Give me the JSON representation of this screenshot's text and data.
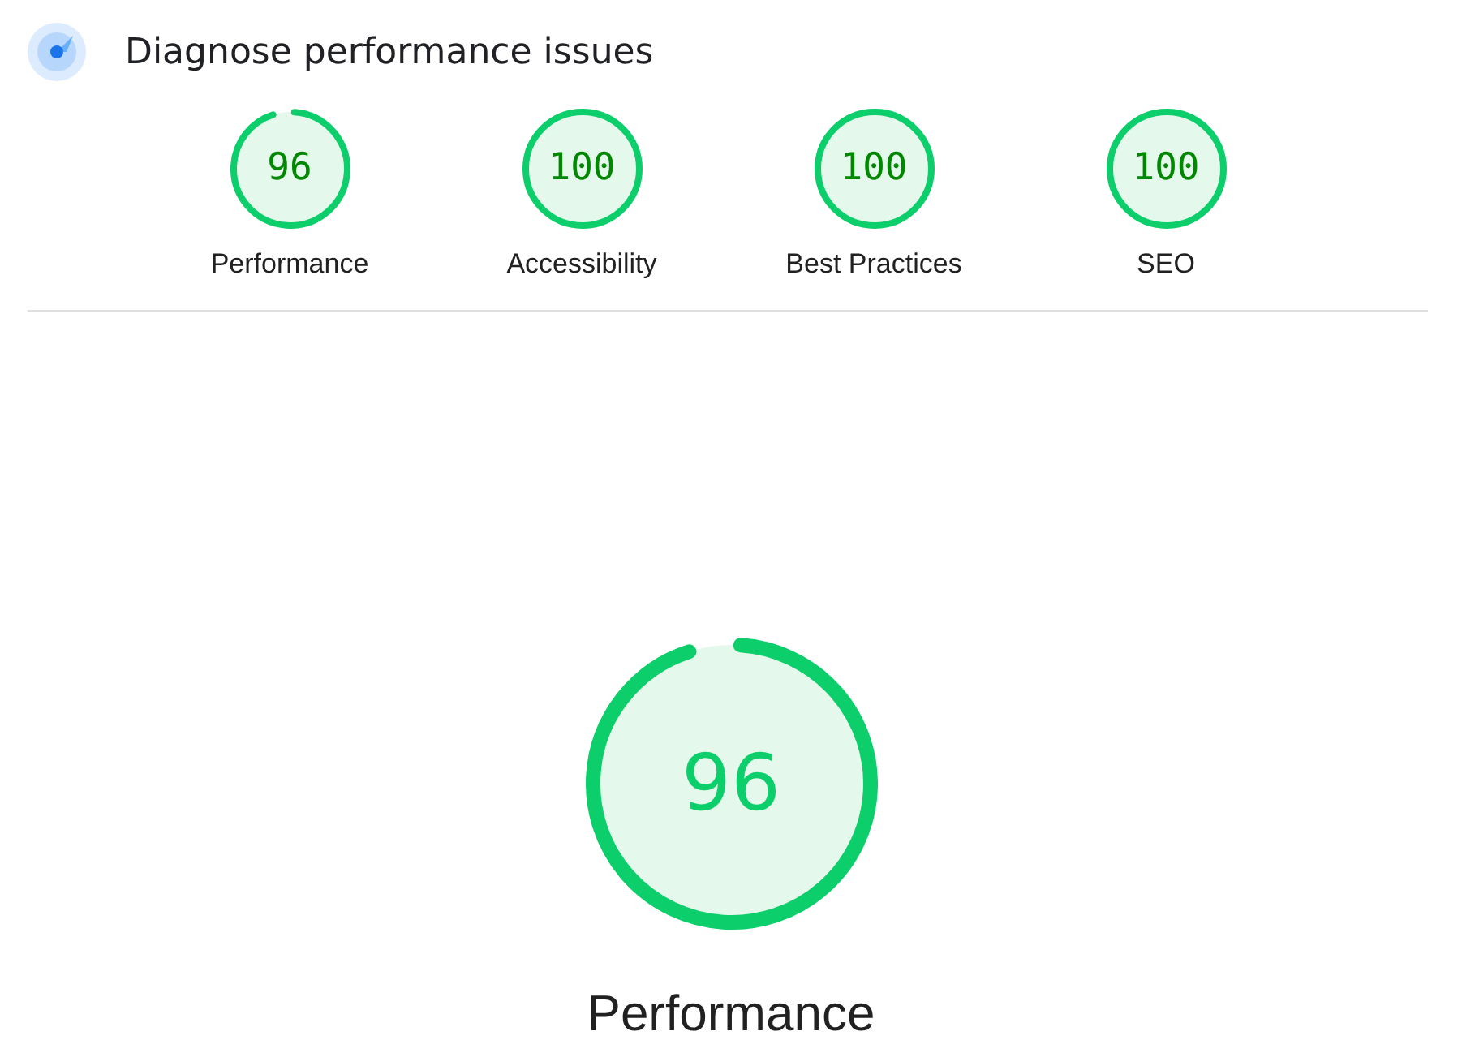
{
  "header": {
    "title": "Diagnose performance issues"
  },
  "gauges": [
    {
      "score": "96",
      "label": "Performance"
    },
    {
      "score": "100",
      "label": "Accessibility"
    },
    {
      "score": "100",
      "label": "Best Practices"
    },
    {
      "score": "100",
      "label": "SEO"
    }
  ],
  "featured": {
    "score": "96",
    "label": "Performance"
  }
}
